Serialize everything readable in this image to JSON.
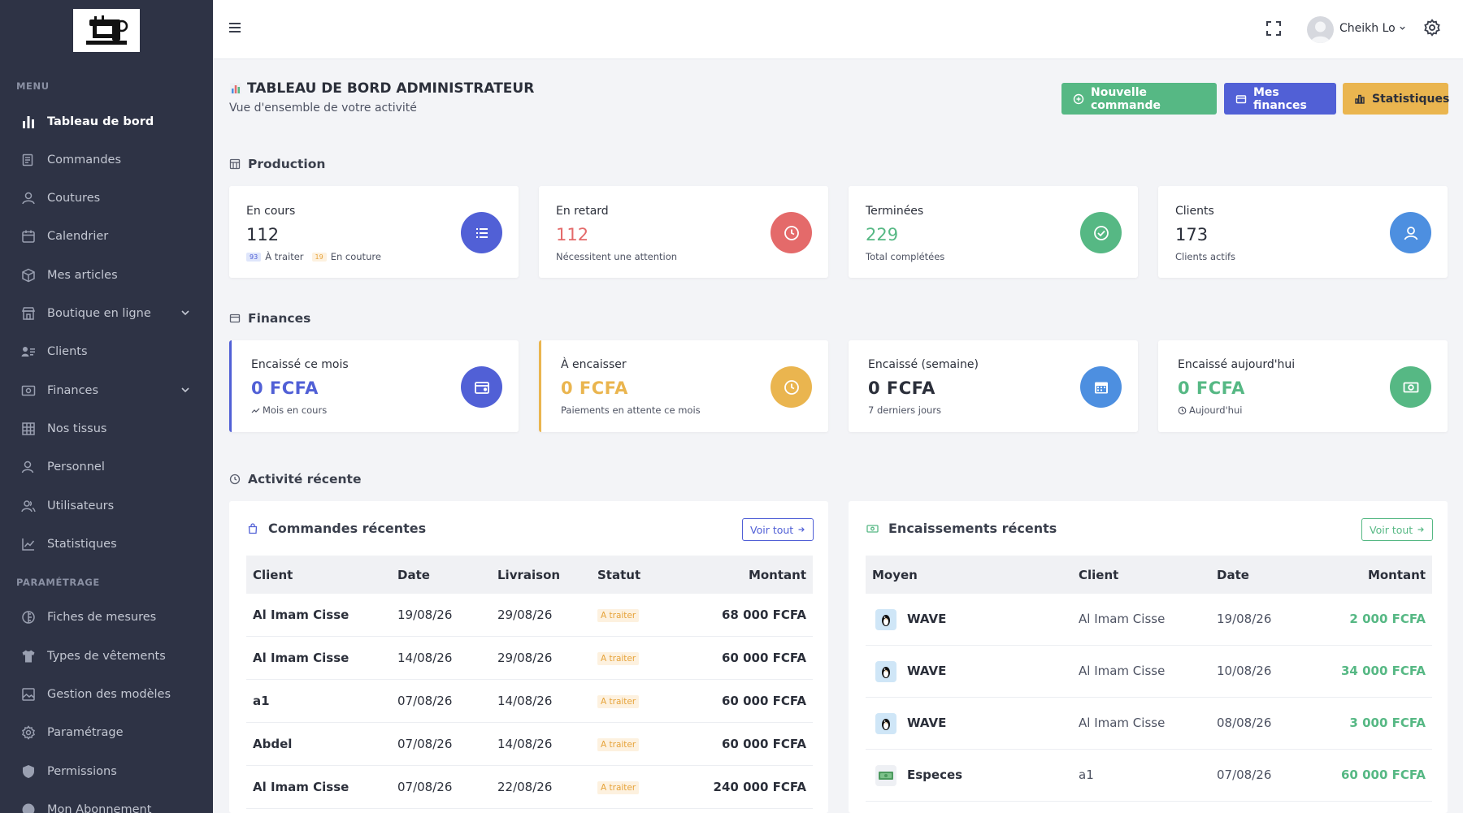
{
  "sidebar": {
    "menu_title": "MENU",
    "settings_title": "PARAMÉTRAGE",
    "items": [
      {
        "label": "Tableau de bord"
      },
      {
        "label": "Commandes"
      },
      {
        "label": "Coutures"
      },
      {
        "label": "Calendrier"
      },
      {
        "label": "Mes articles"
      },
      {
        "label": "Boutique en ligne"
      },
      {
        "label": "Clients"
      },
      {
        "label": "Finances"
      },
      {
        "label": "Nos tissus"
      },
      {
        "label": "Personnel"
      },
      {
        "label": "Utilisateurs"
      },
      {
        "label": "Statistiques"
      }
    ],
    "settings_items": [
      {
        "label": "Fiches de mesures"
      },
      {
        "label": "Types de vêtements"
      },
      {
        "label": "Gestion des modèles"
      },
      {
        "label": "Paramétrage"
      },
      {
        "label": "Permissions"
      },
      {
        "label": "Mon Abonnement"
      }
    ]
  },
  "topbar": {
    "username": "Cheikh Lo"
  },
  "header": {
    "title": "TABLEAU DE BORD ADMINISTRATEUR",
    "subtitle": "Vue d'ensemble de votre activité",
    "btn_new": "Nouvelle commande",
    "btn_finances": "Mes finances",
    "btn_stats": "Statistiques"
  },
  "production": {
    "title": "Production",
    "cards": [
      {
        "label": "En cours",
        "value": "112",
        "sub_a_badge": "93",
        "sub_a": "À traiter",
        "sub_b_badge": "19",
        "sub_b": "En couture"
      },
      {
        "label": "En retard",
        "value": "112",
        "sub": "Nécessitent une attention"
      },
      {
        "label": "Terminées",
        "value": "229",
        "sub": "Total complétées"
      },
      {
        "label": "Clients",
        "value": "173",
        "sub": "Clients actifs"
      }
    ]
  },
  "finances": {
    "title": "Finances",
    "cards": [
      {
        "label": "Encaissé ce mois",
        "value": "0 FCFA",
        "sub": "Mois en cours"
      },
      {
        "label": "À encaisser",
        "value": "0 FCFA",
        "sub": "Paiements en attente ce mois"
      },
      {
        "label": "Encaissé (semaine)",
        "value": "0 FCFA",
        "sub": "7 derniers jours"
      },
      {
        "label": "Encaissé aujourd'hui",
        "value": "0 FCFA",
        "sub": "Aujourd'hui"
      }
    ]
  },
  "activity": {
    "title": "Activité récente",
    "orders": {
      "title": "Commandes récentes",
      "voir": "Voir tout",
      "headers": [
        "Client",
        "Date",
        "Livraison",
        "Statut",
        "Montant"
      ],
      "rows": [
        {
          "client": "Al Imam Cisse",
          "date": "19/08/26",
          "livraison": "29/08/26",
          "statut": "A traiter",
          "montant": "68 000 FCFA"
        },
        {
          "client": "Al Imam Cisse",
          "date": "14/08/26",
          "livraison": "29/08/26",
          "statut": "A traiter",
          "montant": "60 000 FCFA"
        },
        {
          "client": "a1",
          "date": "07/08/26",
          "livraison": "14/08/26",
          "statut": "A traiter",
          "montant": "60 000 FCFA"
        },
        {
          "client": "Abdel",
          "date": "07/08/26",
          "livraison": "14/08/26",
          "statut": "A traiter",
          "montant": "60 000 FCFA"
        },
        {
          "client": "Al Imam Cisse",
          "date": "07/08/26",
          "livraison": "22/08/26",
          "statut": "A traiter",
          "montant": "240 000 FCFA"
        }
      ]
    },
    "payments": {
      "title": "Encaissements récents",
      "voir": "Voir tout",
      "headers": [
        "Moyen",
        "Client",
        "Date",
        "Montant"
      ],
      "rows": [
        {
          "moyen": "WAVE",
          "client": "Al Imam Cisse",
          "date": "19/08/26",
          "montant": "2 000 FCFA"
        },
        {
          "moyen": "WAVE",
          "client": "Al Imam Cisse",
          "date": "10/08/26",
          "montant": "34 000 FCFA"
        },
        {
          "moyen": "WAVE",
          "client": "Al Imam Cisse",
          "date": "08/08/26",
          "montant": "3 000 FCFA"
        },
        {
          "moyen": "Especes",
          "client": "a1",
          "date": "07/08/26",
          "montant": "60 000 FCFA"
        }
      ]
    }
  },
  "colors": {
    "sidebar_bg": "#2e3345",
    "green": "#56b884",
    "blue": "#5160d6",
    "yellow": "#eab54f",
    "red": "#e46a6a",
    "sky": "#4d8fe0"
  }
}
